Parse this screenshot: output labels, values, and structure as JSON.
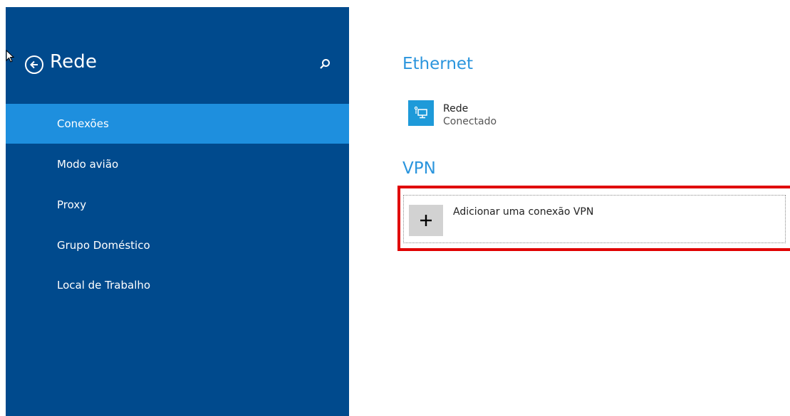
{
  "sidebar": {
    "title": "Rede",
    "items": [
      {
        "label": "Conexões",
        "active": true
      },
      {
        "label": "Modo avião",
        "active": false
      },
      {
        "label": "Proxy",
        "active": false
      },
      {
        "label": "Grupo Doméstico",
        "active": false
      },
      {
        "label": "Local de Trabalho",
        "active": false
      }
    ],
    "icons": {
      "back": "back-arrow-icon",
      "search": "search-icon"
    }
  },
  "ethernet": {
    "section_title": "Ethernet",
    "network": {
      "name": "Rede",
      "status": "Conectado",
      "icon": "network-computer-icon"
    }
  },
  "vpn": {
    "section_title": "VPN",
    "add_label": "Adicionar uma conexão VPN",
    "add_icon": "plus-icon"
  },
  "colors": {
    "sidebar_bg": "#004a8d",
    "active_item": "#1e8fde",
    "accent": "#2b95dd",
    "highlight": "#e00000"
  }
}
